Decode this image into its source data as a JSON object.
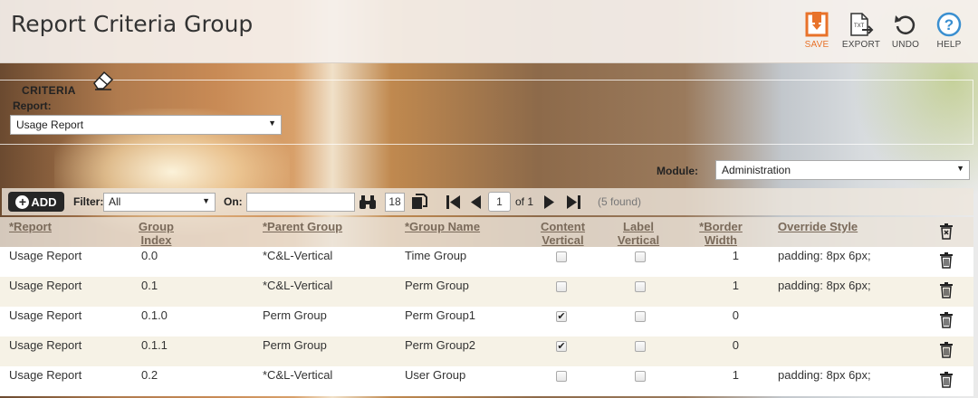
{
  "header": {
    "title": "Report Criteria Group",
    "toolbar": {
      "save": "SAVE",
      "export": "EXPORT",
      "undo": "UNDO",
      "help": "HELP",
      "export_icon_text": "TXT"
    }
  },
  "criteria": {
    "legend": "CRITERIA",
    "report_label": "Report:",
    "report_value": "Usage Report",
    "module_label": "Module:",
    "module_value": "Administration"
  },
  "grid_toolbar": {
    "add_label": "ADD",
    "filter_label": "Filter:",
    "filter_value": "All",
    "on_label": "On:",
    "on_value": "",
    "page_size": "18",
    "current_page": "1",
    "of_label": "of 1",
    "found_label": "(5 found)"
  },
  "table": {
    "headers": {
      "report": "*Report",
      "group_index_1": "Group",
      "group_index_2": "Index",
      "parent_group": "*Parent Group",
      "group_name": "*Group Name",
      "content_vertical_1": "Content",
      "content_vertical_2": "Vertical",
      "label_vertical_1": "Label",
      "label_vertical_2": "Vertical",
      "border_width_1": "*Border",
      "border_width_2": "Width",
      "override_style": "Override Style"
    },
    "rows": [
      {
        "report": "Usage Report",
        "group_index": "0.0",
        "parent_group": "*C&L-Vertical",
        "group_name": "Time Group",
        "content_vertical": false,
        "label_vertical": false,
        "border_width": "1",
        "override_style": "padding: 8px 6px;"
      },
      {
        "report": "Usage Report",
        "group_index": "0.1",
        "parent_group": "*C&L-Vertical",
        "group_name": "Perm Group",
        "content_vertical": false,
        "label_vertical": false,
        "border_width": "1",
        "override_style": "padding: 8px 6px;"
      },
      {
        "report": "Usage Report",
        "group_index": "0.1.0",
        "parent_group": "Perm Group",
        "group_name": "Perm Group1",
        "content_vertical": true,
        "label_vertical": false,
        "border_width": "0",
        "override_style": ""
      },
      {
        "report": "Usage Report",
        "group_index": "0.1.1",
        "parent_group": "Perm Group",
        "group_name": "Perm Group2",
        "content_vertical": true,
        "label_vertical": false,
        "border_width": "0",
        "override_style": ""
      },
      {
        "report": "Usage Report",
        "group_index": "0.2",
        "parent_group": "*C&L-Vertical",
        "group_name": "User Group",
        "content_vertical": false,
        "label_vertical": false,
        "border_width": "1",
        "override_style": "padding: 8px 6px;"
      }
    ]
  },
  "colors": {
    "save_accent": "#e8722a",
    "help_accent": "#3a8fd0",
    "header_link": "#7a6a5a",
    "row_alt": "#f6f2e6"
  }
}
